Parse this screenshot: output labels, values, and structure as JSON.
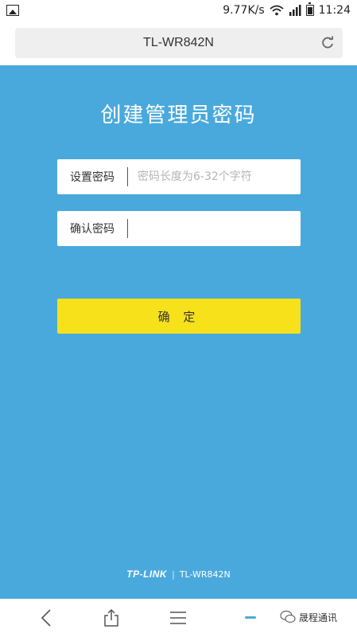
{
  "status_bar": {
    "speed": "9.77K/s",
    "time": "11:24",
    "icons": [
      "gallery-icon",
      "wifi-icon",
      "signal-icon",
      "battery-icon"
    ]
  },
  "browser": {
    "url_title": "TL-WR842N",
    "reload_icon": "reload-icon"
  },
  "page": {
    "title": "创建管理员密码",
    "password_field": {
      "label": "设置密码",
      "placeholder": "密码长度为6-32个字符",
      "value": ""
    },
    "confirm_field": {
      "label": "确认密码",
      "value": ""
    },
    "confirm_button": "确 定",
    "footer": {
      "brand": "TP-LINK",
      "separator": "|",
      "model": "TL-WR842N"
    }
  },
  "bottom_nav": {
    "items": [
      "back-icon",
      "share-icon",
      "menu-icon"
    ],
    "watermark": "晟程通讯"
  },
  "colors": {
    "page_bg": "#4aa9dc",
    "button_bg": "#f7e11b",
    "text_white": "#ffffff"
  }
}
